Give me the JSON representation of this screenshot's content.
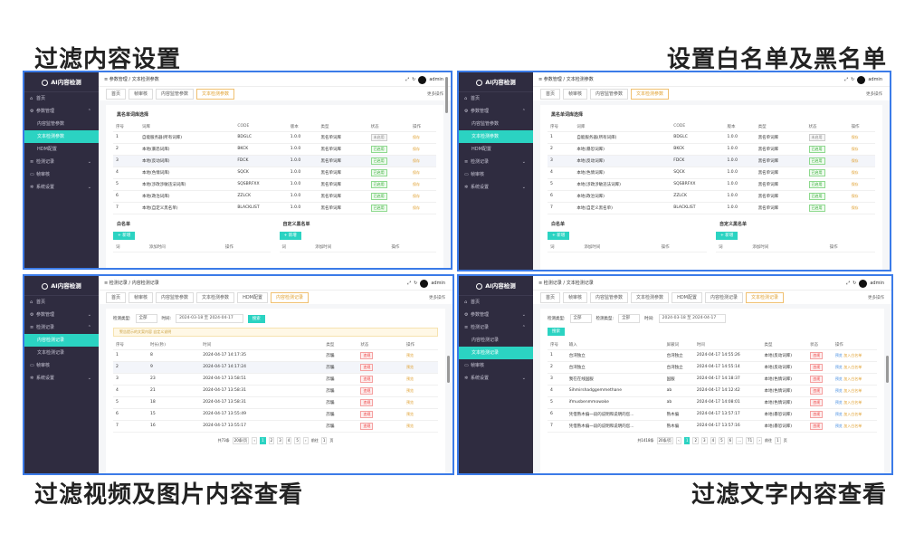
{
  "captions": {
    "tl": "过滤内容设置",
    "tr": "设置白名单及黑名单",
    "bl": "过滤视频及图片内容查看",
    "br": "过滤文字内容查看"
  },
  "app": {
    "title": "AI内容检测",
    "user": "admin",
    "more": "更多操作"
  },
  "nav": {
    "home": "首页",
    "params": "参数管理",
    "content_settings": "内容监管参数",
    "text_params": "文本检测参数",
    "hdm": "HDM配置",
    "records": "检测记录",
    "content_records": "内容检测记录",
    "text_records": "文本检测记录",
    "frame": "帧审核",
    "system": "系统设置"
  },
  "tabs": {
    "home": "首页",
    "frame": "帧审核",
    "content": "内容监管参数",
    "text": "文本检测参数",
    "hdm": "HDM配置",
    "content_rec": "内容检测记录",
    "text_rec": "文本检测记录"
  },
  "crumb1": {
    "a": "参数管理",
    "b": "文本检测参数"
  },
  "crumb2": {
    "a": "检测记录",
    "b": "内容检测记录"
  },
  "crumb3": {
    "a": "检测记录",
    "b": "文本检测记录"
  },
  "params": {
    "section": "黑名单词库选择",
    "headers": [
      "序号",
      "词库",
      "CODE",
      "版本",
      "类型",
      "状态",
      "操作"
    ],
    "rows": [
      [
        "1",
        "自能服务器(所有词库)",
        "BDGLC",
        "1.0.0",
        "黑名单词库",
        "未启用",
        "保存"
      ],
      [
        "2",
        "本地(暴恐词库)",
        "BKCK",
        "1.0.0",
        "黑名单词库",
        "已启用",
        "保存"
      ],
      [
        "3",
        "本地(反动词库)",
        "FDCK",
        "1.0.0",
        "黑名单词库",
        "已启用",
        "保存"
      ],
      [
        "4",
        "本地(色情词库)",
        "SQCK",
        "1.0.0",
        "黑名单词库",
        "已启用",
        "保存"
      ],
      [
        "5",
        "本地(涉政涉敏违法词库)",
        "SQSBRFXX",
        "1.0.0",
        "黑名单词库",
        "已启用",
        "保存"
      ],
      [
        "6",
        "本地(政治词库)",
        "ZZLCK",
        "1.0.0",
        "黑名单词库",
        "已启用",
        "保存"
      ],
      [
        "7",
        "本地(自定义黑名单)",
        "BLACKLIST",
        "1.0.0",
        "黑名单词库",
        "已启用",
        "保存"
      ]
    ],
    "whitelist": "白名单",
    "custom": "自定义黑名单",
    "add": "+ 新增",
    "sub_headers": [
      "词",
      "添加时间",
      "操作"
    ]
  },
  "content_rec": {
    "filter_label": "检测类型:",
    "filter_val": "全部",
    "time_label": "时间:",
    "date_range": "2024-03-18 至 2024-04-17",
    "search": "搜索",
    "notice": "警告提示的文案内容 自定义说明",
    "headers": [
      "序号",
      "时长(秒)",
      "时间",
      "类型",
      "状态",
      "操作"
    ],
    "rows": [
      [
        "1",
        "8",
        "2024-04-17 14:17:35",
        "詐騙",
        "违规",
        "预览"
      ],
      [
        "2",
        "9",
        "2024-04-17 14:17:24",
        "詐騙",
        "违规",
        "预览"
      ],
      [
        "3",
        "23",
        "2024-04-17 13:58:51",
        "詐騙",
        "违规",
        "预览"
      ],
      [
        "4",
        "21",
        "2024-04-17 13:58:31",
        "詐騙",
        "违规",
        "预览"
      ],
      [
        "5",
        "18",
        "2024-04-17 13:58:31",
        "詐騙",
        "违规",
        "预览"
      ],
      [
        "6",
        "15",
        "2024-04-17 13:55:49",
        "詐騙",
        "违规",
        "预览"
      ],
      [
        "7",
        "16",
        "2024-04-17 13:55:17",
        "詐騙",
        "违规",
        "预览"
      ]
    ],
    "total": "共73条",
    "per_page": "20条/页",
    "pages": [
      "1",
      "2",
      "3",
      "4",
      "5"
    ],
    "goto": "前往",
    "goto_val": "1",
    "page_unit": "页"
  },
  "text_rec": {
    "filter_label": "检测类型:",
    "filter_val": "全部",
    "type_label": "检测类型:",
    "type_val": "全部",
    "time_label": "时间:",
    "date_range": "2024-03-18 至 2024-04-17",
    "search": "搜索",
    "headers": [
      "序号",
      "输入",
      "屏蔽词",
      "时间",
      "类型",
      "状态",
      "操作"
    ],
    "rows": [
      [
        "1",
        "台湾独立",
        "台湾独立",
        "2024-04-17 14:55:26",
        "本地(反动词库)",
        "违规",
        "预览  加入白名单"
      ],
      [
        "2",
        "台湾独立",
        "台湾独立",
        "2024-04-17 14:55:14",
        "本地(反动词库)",
        "违规",
        "预览  加入白名单"
      ],
      [
        "3",
        "我在在线国服",
        "国服",
        "2024-04-17 14:18:37",
        "本地(色情词库)",
        "违规",
        "预览  加入白名单"
      ],
      [
        "4",
        "Sihmirshadggemmethane",
        "ab",
        "2024-04-17 14:12:42",
        "本地(色情词库)",
        "违规",
        "预览  加入白名单"
      ],
      [
        "5",
        "ifmusbenmmowake",
        "ab",
        "2024-04-17 14:08:01",
        "本地(色情词库)",
        "违规",
        "预览  加入白名单"
      ],
      [
        "6",
        "凭借熟木偏一段的说明和说明的您...",
        "熟木偏",
        "2024-04-17 13:57:17",
        "本地(暴恐词库)",
        "违规",
        "预览  加入白名单"
      ],
      [
        "7",
        "凭借熟木偏一段的说明和说明的您...",
        "熟木偏",
        "2024-04-17 13:57:16",
        "本地(暴恐词库)",
        "违规",
        "预览  加入白名单"
      ]
    ],
    "total": "共1418条",
    "per_page": "20条/页",
    "pages": [
      "1",
      "2",
      "3",
      "4",
      "5",
      "6",
      "...",
      "71"
    ],
    "goto": "前往",
    "goto_val": "1",
    "page_unit": "页"
  },
  "colors": {
    "accent": "#2bd3c2",
    "sidebar": "#2f2c40",
    "frame": "#3b7be8"
  }
}
